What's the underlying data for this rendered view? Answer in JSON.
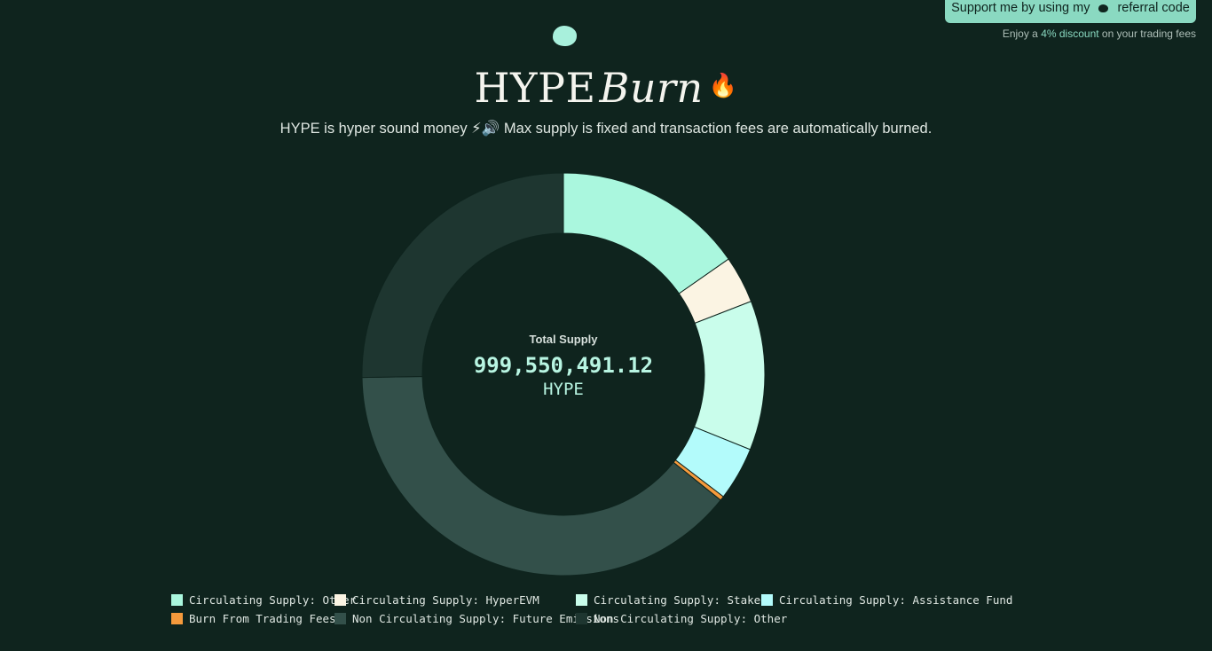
{
  "referral": {
    "prefix": "Support me by using my",
    "suffix": "referral code",
    "note_prefix": "Enjoy a",
    "note_highlight": "4% discount",
    "note_suffix": "on your trading fees"
  },
  "header": {
    "title_main": "HYPE",
    "title_italic": "Burn",
    "title_emoji": "🔥",
    "subtitle": "HYPE is hyper sound money ⚡🔊 Max supply is fixed and transaction fees are automatically burned."
  },
  "center": {
    "caption": "Total Supply",
    "value": "999,550,491.12",
    "unit": "HYPE"
  },
  "chart_data": {
    "type": "pie",
    "title": "",
    "total": 999550491.12,
    "unit": "HYPE",
    "slices": [
      {
        "name": "Circulating Supply: Other",
        "value": 15.3,
        "color": "#aaf7de"
      },
      {
        "name": "Circulating Supply: HyperEVM",
        "value": 3.8,
        "color": "#fbf4e3"
      },
      {
        "name": "Circulating Supply: Staked",
        "value": 12.0,
        "color": "#c9fdeb"
      },
      {
        "name": "Circulating Supply: Assistance Fund",
        "value": 4.3,
        "color": "#b3fbfb"
      },
      {
        "name": "Burn From Trading Fees",
        "value": 0.35,
        "color": "#f59a3c"
      },
      {
        "name": "Non Circulating Supply: Future Emissions",
        "value": 39.0,
        "color": "#33504a"
      },
      {
        "name": "Non Circulating Supply: Other",
        "value": 25.25,
        "color": "#1e3630"
      }
    ],
    "legend_position": "bottom"
  }
}
